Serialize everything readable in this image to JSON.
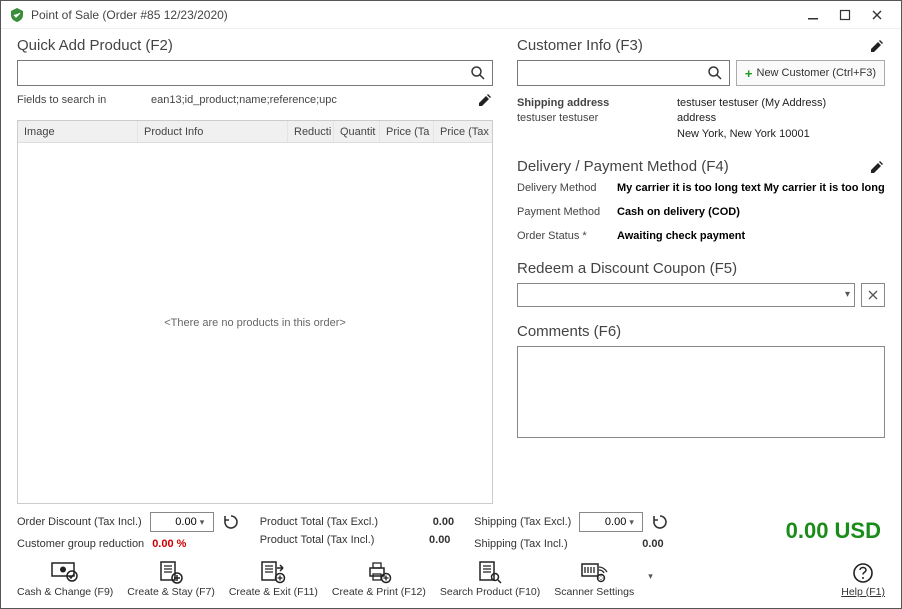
{
  "titlebar": {
    "text": "Point of Sale (Order #85 12/23/2020)"
  },
  "quickAdd": {
    "title": "Quick Add Product (F2)",
    "fieldsLabel": "Fields to search in",
    "fieldsValue": "ean13;id_product;name;reference;upc"
  },
  "grid": {
    "headers": [
      "Image",
      "Product Info",
      "Reducti",
      "Quantit",
      "Price (Ta",
      "Price (Tax I"
    ],
    "empty": "<There are no products in this order>"
  },
  "customer": {
    "title": "Customer Info (F3)",
    "newCustomer": "New Customer (Ctrl+F3)",
    "rows": {
      "shipLabel": "Shipping address",
      "shipName": "testuser testuser",
      "addrLine1": "testuser testuser (My Address)",
      "addrLine2": "address",
      "addrLine3": "New York, New York 10001"
    }
  },
  "delivery": {
    "title": "Delivery / Payment Method (F4)",
    "deliveryMethodLabel": "Delivery Method",
    "deliveryMethodValue": "My carrier it is too long text My carrier it is too long text",
    "paymentMethodLabel": "Payment Method",
    "paymentMethodValue": "Cash on delivery (COD)",
    "orderStatusLabel": "Order Status *",
    "orderStatusValue": "Awaiting check payment"
  },
  "coupon": {
    "title": "Redeem a Discount Coupon (F5)"
  },
  "comments": {
    "title": "Comments (F6)",
    "value": ""
  },
  "totals": {
    "orderDiscountLabel": "Order Discount (Tax Incl.)",
    "orderDiscountValue": "0.00",
    "customerGroupLabel": "Customer group reduction",
    "customerGroupValue": "0.00 %",
    "productTotalExclLabel": "Product Total (Tax Excl.)",
    "productTotalExclValue": "0.00",
    "productTotalInclLabel": "Product Total (Tax Incl.)",
    "productTotalInclValue": "0.00",
    "shippingExclLabel": "Shipping (Tax Excl.)",
    "shippingExclValue": "0.00",
    "shippingInclLabel": "Shipping (Tax Incl.)",
    "shippingInclValue": "0.00",
    "grandTotal": "0.00 USD"
  },
  "footer": {
    "cashChange": "Cash & Change (F9)",
    "createStay": "Create & Stay (F7)",
    "createExit": "Create & Exit (F11)",
    "createPrint": "Create & Print (F12)",
    "searchProduct": "Search Product (F10)",
    "scannerSettings": "Scanner Settings",
    "help": "Help (F1)"
  }
}
